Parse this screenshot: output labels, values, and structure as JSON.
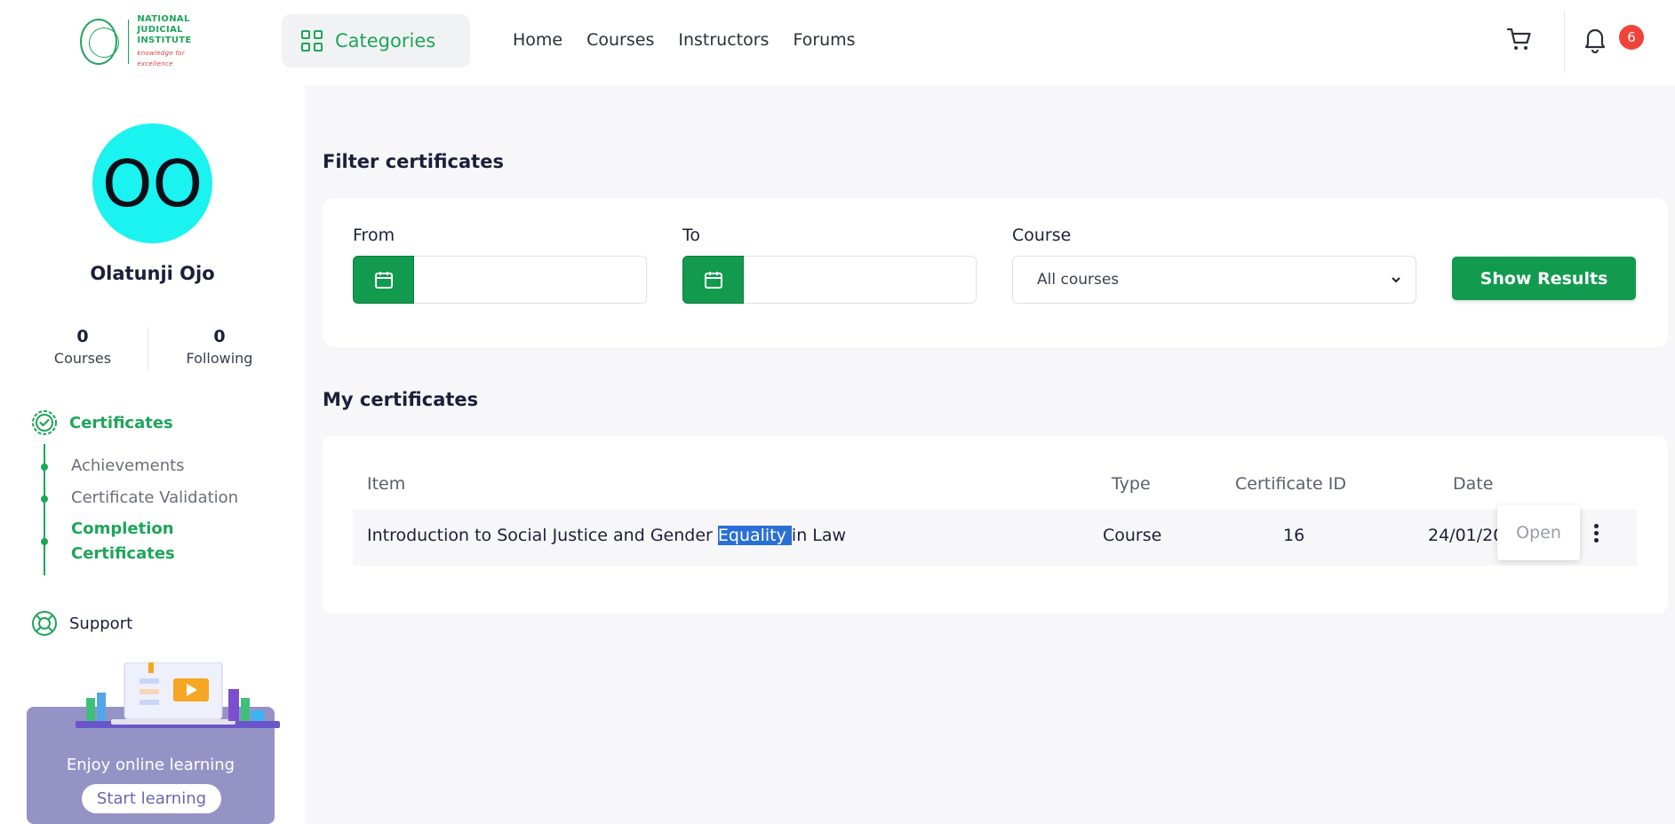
{
  "header": {
    "logo_lines": [
      "NATIONAL",
      "JUDICIAL",
      "INSTITUTE"
    ],
    "logo_tagline": "knowledge for excellence",
    "categories_label": "Categories",
    "nav": [
      "Home",
      "Courses",
      "Instructors",
      "Forums"
    ],
    "notification_count": "6"
  },
  "sidebar": {
    "avatar_initials": "OO",
    "avatar_color": "#1af3f0",
    "user_name": "Olatunji Ojo",
    "stats": [
      {
        "value": "0",
        "label": "Courses"
      },
      {
        "value": "0",
        "label": "Following"
      }
    ],
    "menu_main": "Certificates",
    "submenu": [
      "Achievements",
      "Certificate Validation",
      "Completion Certificates"
    ],
    "support_label": "Support",
    "promo_title": "Enjoy online learning",
    "promo_button": "Start learning"
  },
  "filter": {
    "title": "Filter certificates",
    "from_label": "From",
    "to_label": "To",
    "course_label": "Course",
    "course_selected": "All courses",
    "show_button": "Show Results"
  },
  "certificates": {
    "title": "My certificates",
    "columns": [
      "Item",
      "Type",
      "Certificate ID",
      "Date"
    ],
    "rows": [
      {
        "item_before": "Introduction to Social Justice and Gender ",
        "item_highlight": "Equality ",
        "item_after": "in Law",
        "type": "Course",
        "id": "16",
        "date": "24/01/20"
      }
    ],
    "popup_option": "Open"
  },
  "colors": {
    "accent": "#1ea55a",
    "button": "#129b4f",
    "badge": "#f0443a"
  }
}
